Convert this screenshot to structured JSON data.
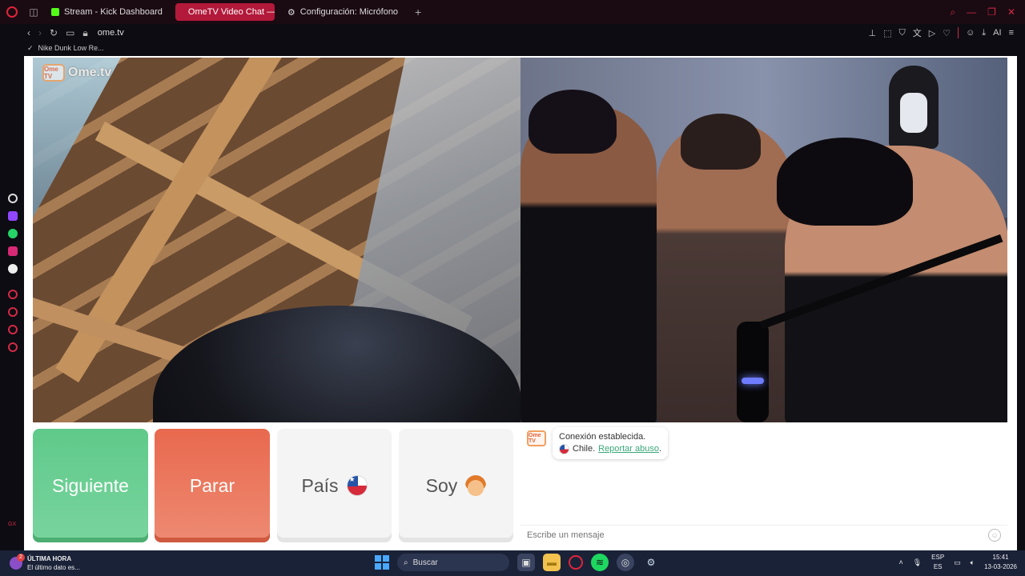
{
  "browser": {
    "tabs": [
      {
        "label": "Stream - Kick Dashboard",
        "color": "#53fc18",
        "active": false
      },
      {
        "label": "OmeTV Video Chat —",
        "color": "#ffffff",
        "active": true
      },
      {
        "label": "Configuración: Micrófono",
        "color": "#cccccc",
        "active": false
      }
    ],
    "url": "ome.tv",
    "ai_label": "AI",
    "bookmark": "Nike Dunk Low Re..."
  },
  "page": {
    "logo_text": "Ome.tv",
    "logo_badge": "Ome TV",
    "buttons": {
      "next": "Siguiente",
      "stop": "Parar",
      "country": "País",
      "gender": "Soy"
    },
    "chat": {
      "message_line1": "Conexión establecida.",
      "country": "Chile.",
      "report_link": "Reportar abuso",
      "period": ".",
      "input_placeholder": "Escribe un mensaje"
    }
  },
  "taskbar": {
    "news_title": "ÚLTIMA HORA",
    "news_subtitle": "El último dato es...",
    "search_label": "Buscar",
    "lang_top": "ESP",
    "lang_bottom": "ES",
    "time": "15:41",
    "date": "13-03-2026"
  },
  "colors": {
    "accent": "#b3193a",
    "next_green": "#5fca8a",
    "stop_red": "#e8694e",
    "report_link": "#3aa87a"
  }
}
